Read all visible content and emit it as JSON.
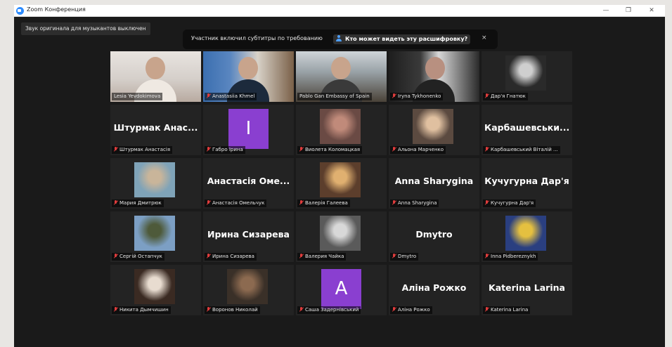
{
  "window": {
    "title": "Zoom Конференция",
    "minimize": "—",
    "restore": "❐",
    "close": "✕"
  },
  "toolbar": {
    "original_sound": "Звук оригинала для музыкантов выключен"
  },
  "caption_banner": {
    "message": "Участник включил субтитры по требованию",
    "who_can_see": "Кто может видеть эту расшифровку?",
    "close": "×"
  },
  "colors": {
    "active_speaker": "#c3d94a",
    "muted": "#e03c3c",
    "avatar_purple": "#8a3fd0"
  },
  "participants": [
    {
      "name": "Lesia Yevdokimova",
      "display": "",
      "muted": false
    },
    {
      "name": "Anastasiia Khmel",
      "display": "",
      "muted": true
    },
    {
      "name": "Pablo Gan Embassy of Spain",
      "display": "",
      "muted": false
    },
    {
      "name": "Iryna Tykhonenko",
      "display": "",
      "muted": true
    },
    {
      "name": "Дар'я Гнатюк",
      "display": "",
      "muted": true
    },
    {
      "name": "Штурмак Анастасія",
      "display": "Штурмак Анас...",
      "muted": true
    },
    {
      "name": "Габро Ірина",
      "display": "I",
      "muted": true
    },
    {
      "name": "Виолета Коломацкая",
      "display": "",
      "muted": true
    },
    {
      "name": "Альона Марченко",
      "display": "",
      "muted": true
    },
    {
      "name": "Карбашевський Віталій ...",
      "display": "Карбашевськи...",
      "muted": true
    },
    {
      "name": "Мария Дмитрюк",
      "display": "",
      "muted": true
    },
    {
      "name": "Анастасія Омельчук",
      "display": "Анастасія Оме...",
      "muted": true
    },
    {
      "name": "Валерія Галеева",
      "display": "",
      "muted": true
    },
    {
      "name": "Anna Sharygina",
      "display": "Anna Sharygina",
      "muted": true
    },
    {
      "name": "Кучугурна Дар'я",
      "display": "Кучугурна Дар'я",
      "muted": true
    },
    {
      "name": "Сергій Остапчук",
      "display": "",
      "muted": true
    },
    {
      "name": "Ирина Сизарева",
      "display": "Ирина Сизарева",
      "muted": true
    },
    {
      "name": "Валерия Чайка",
      "display": "",
      "muted": true
    },
    {
      "name": "Dmytro",
      "display": "Dmytro",
      "muted": true
    },
    {
      "name": "Inna Pidbereznykh",
      "display": "",
      "muted": true
    },
    {
      "name": "Никита Дымчишин",
      "display": "",
      "muted": true
    },
    {
      "name": "Воронов Николай",
      "display": "",
      "muted": true
    },
    {
      "name": "Саша Задернівський",
      "display": "A",
      "muted": true
    },
    {
      "name": "Аліна Рожко",
      "display": "Аліна Рожко",
      "muted": true
    },
    {
      "name": "Katerina Larina",
      "display": "Katerina Larina",
      "muted": true
    }
  ]
}
